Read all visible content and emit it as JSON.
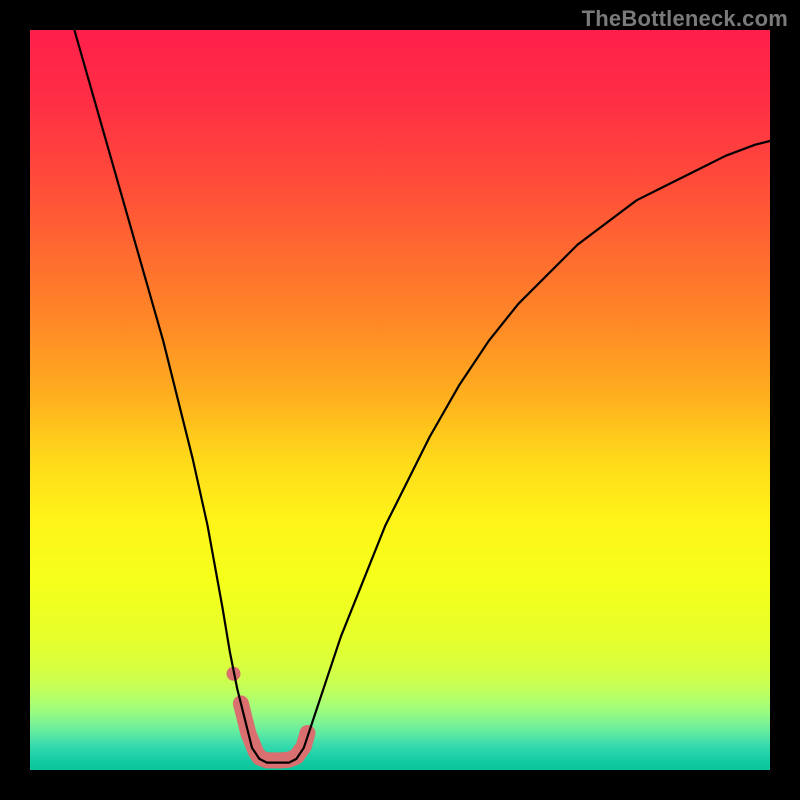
{
  "watermark": "TheBottleneck.com",
  "chart_data": {
    "type": "line",
    "title": "",
    "xlabel": "",
    "ylabel": "",
    "xlim": [
      0,
      100
    ],
    "ylim": [
      0,
      100
    ],
    "curve": {
      "name": "bottleneck-curve",
      "x": [
        6,
        8,
        10,
        12,
        14,
        16,
        18,
        20,
        22,
        24,
        26,
        27,
        28,
        29,
        30,
        31,
        32,
        33,
        34,
        35,
        36,
        37,
        38,
        40,
        42,
        44,
        46,
        48,
        50,
        54,
        58,
        62,
        66,
        70,
        74,
        78,
        82,
        86,
        90,
        94,
        98,
        100
      ],
      "y": [
        100,
        93,
        86,
        79,
        72,
        65,
        58,
        50,
        42,
        33,
        22,
        16,
        11,
        7,
        3,
        1.5,
        1,
        1,
        1,
        1,
        1.5,
        3,
        6,
        12,
        18,
        23,
        28,
        33,
        37,
        45,
        52,
        58,
        63,
        67,
        71,
        74,
        77,
        79,
        81,
        83,
        84.5,
        85
      ],
      "color": "#000000",
      "stroke_width": 2.2
    },
    "highlight_segment": {
      "name": "optimal-range",
      "x": [
        28.5,
        29.5,
        30.5,
        31,
        32,
        33,
        34,
        35,
        36,
        37,
        37.5
      ],
      "y": [
        9,
        5,
        2.5,
        1.7,
        1.3,
        1.3,
        1.3,
        1.4,
        1.8,
        3.2,
        5
      ],
      "color": "#d9706f",
      "stroke_width": 16
    },
    "highlight_dot": {
      "x": 27.5,
      "y": 13,
      "r": 7,
      "color": "#d9706f"
    },
    "gradient_stops": [
      {
        "offset": 0.0,
        "color": "#ff1f4b"
      },
      {
        "offset": 0.1,
        "color": "#ff2f44"
      },
      {
        "offset": 0.2,
        "color": "#ff4a3a"
      },
      {
        "offset": 0.3,
        "color": "#ff6a30"
      },
      {
        "offset": 0.4,
        "color": "#ff8a26"
      },
      {
        "offset": 0.5,
        "color": "#ffb11e"
      },
      {
        "offset": 0.58,
        "color": "#ffd91a"
      },
      {
        "offset": 0.66,
        "color": "#fff319"
      },
      {
        "offset": 0.74,
        "color": "#f6ff1a"
      },
      {
        "offset": 0.82,
        "color": "#e7ff2a"
      },
      {
        "offset": 0.86,
        "color": "#d8ff3f"
      },
      {
        "offset": 0.885,
        "color": "#c8ff55"
      },
      {
        "offset": 0.905,
        "color": "#b2ff6c"
      },
      {
        "offset": 0.922,
        "color": "#98fb82"
      },
      {
        "offset": 0.938,
        "color": "#7af295"
      },
      {
        "offset": 0.952,
        "color": "#5ae8a3"
      },
      {
        "offset": 0.965,
        "color": "#3bdcab"
      },
      {
        "offset": 0.978,
        "color": "#22d2aa"
      },
      {
        "offset": 0.99,
        "color": "#12c9a2"
      },
      {
        "offset": 1.0,
        "color": "#0cc49c"
      }
    ]
  }
}
